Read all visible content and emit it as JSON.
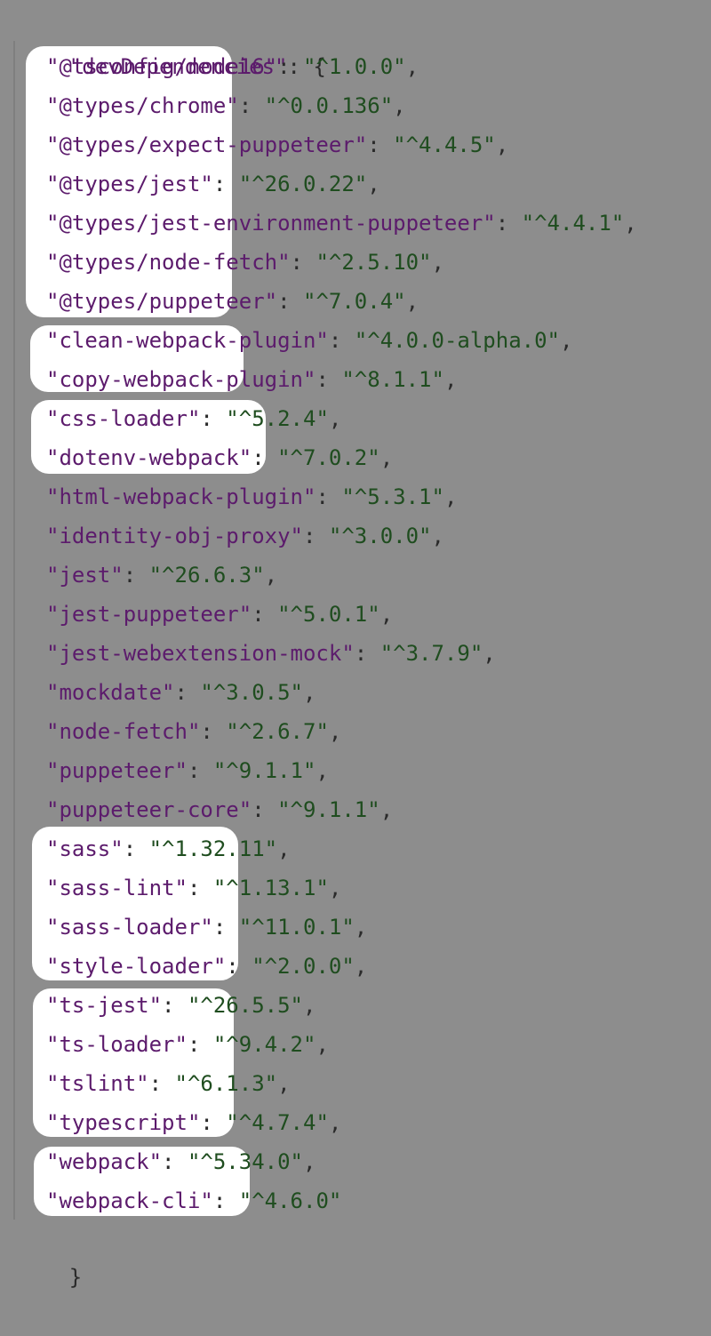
{
  "root_key": "\"devDependencies\"",
  "opening_brace": "{",
  "closing_brace": "}",
  "dependencies": [
    {
      "name": "\"@tsconfig/node16\"",
      "version": "\"^1.0.0\""
    },
    {
      "name": "\"@types/chrome\"",
      "version": "\"^0.0.136\""
    },
    {
      "name": "\"@types/expect-puppeteer\"",
      "version": "\"^4.4.5\""
    },
    {
      "name": "\"@types/jest\"",
      "version": "\"^26.0.22\""
    },
    {
      "name": "\"@types/jest-environment-puppeteer\"",
      "version": "\"^4.4.1\""
    },
    {
      "name": "\"@types/node-fetch\"",
      "version": "\"^2.5.10\""
    },
    {
      "name": "\"@types/puppeteer\"",
      "version": "\"^7.0.4\""
    },
    {
      "name": "\"clean-webpack-plugin\"",
      "version": "\"^4.0.0-alpha.0\""
    },
    {
      "name": "\"copy-webpack-plugin\"",
      "version": "\"^8.1.1\""
    },
    {
      "name": "\"css-loader\"",
      "version": "\"^5.2.4\""
    },
    {
      "name": "\"dotenv-webpack\"",
      "version": "\"^7.0.2\""
    },
    {
      "name": "\"html-webpack-plugin\"",
      "version": "\"^5.3.1\""
    },
    {
      "name": "\"identity-obj-proxy\"",
      "version": "\"^3.0.0\""
    },
    {
      "name": "\"jest\"",
      "version": "\"^26.6.3\""
    },
    {
      "name": "\"jest-puppeteer\"",
      "version": "\"^5.0.1\""
    },
    {
      "name": "\"jest-webextension-mock\"",
      "version": "\"^3.7.9\""
    },
    {
      "name": "\"mockdate\"",
      "version": "\"^3.0.5\""
    },
    {
      "name": "\"node-fetch\"",
      "version": "\"^2.6.7\""
    },
    {
      "name": "\"puppeteer\"",
      "version": "\"^9.1.1\""
    },
    {
      "name": "\"puppeteer-core\"",
      "version": "\"^9.1.1\""
    },
    {
      "name": "\"sass\"",
      "version": "\"^1.32.11\""
    },
    {
      "name": "\"sass-lint\"",
      "version": "\"^1.13.1\""
    },
    {
      "name": "\"sass-loader\"",
      "version": "\"^11.0.1\""
    },
    {
      "name": "\"style-loader\"",
      "version": "\"^2.0.0\""
    },
    {
      "name": "\"ts-jest\"",
      "version": "\"^26.5.5\""
    },
    {
      "name": "\"ts-loader\"",
      "version": "\"^9.4.2\""
    },
    {
      "name": "\"tslint\"",
      "version": "\"^6.1.3\""
    },
    {
      "name": "\"typescript\"",
      "version": "\"^4.7.4\""
    },
    {
      "name": "\"webpack\"",
      "version": "\"^5.34.0\""
    },
    {
      "name": "\"webpack-cli\"",
      "version": "\"^4.6.0\""
    }
  ],
  "colors": {
    "background": "#8d8d8d",
    "highlight": "#ffffff",
    "key": "#5c1b6c",
    "value": "#1f4d1f"
  }
}
